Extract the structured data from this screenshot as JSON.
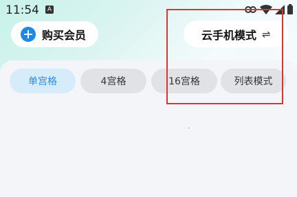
{
  "status_bar": {
    "time": "11:54",
    "notification_icon": "A"
  },
  "header": {
    "buy_member_label": "购买会员",
    "mode_label": "云手机模式",
    "swap_icon": "⇌"
  },
  "tabs": [
    {
      "label": "单宫格",
      "active": true
    },
    {
      "label": "4宫格",
      "active": false
    },
    {
      "label": "16宫格",
      "active": false
    },
    {
      "label": "列表模式",
      "active": false
    }
  ],
  "colors": {
    "accent": "#1e88e5",
    "active_tab_text": "#2c8be0",
    "highlight": "#e03030"
  }
}
